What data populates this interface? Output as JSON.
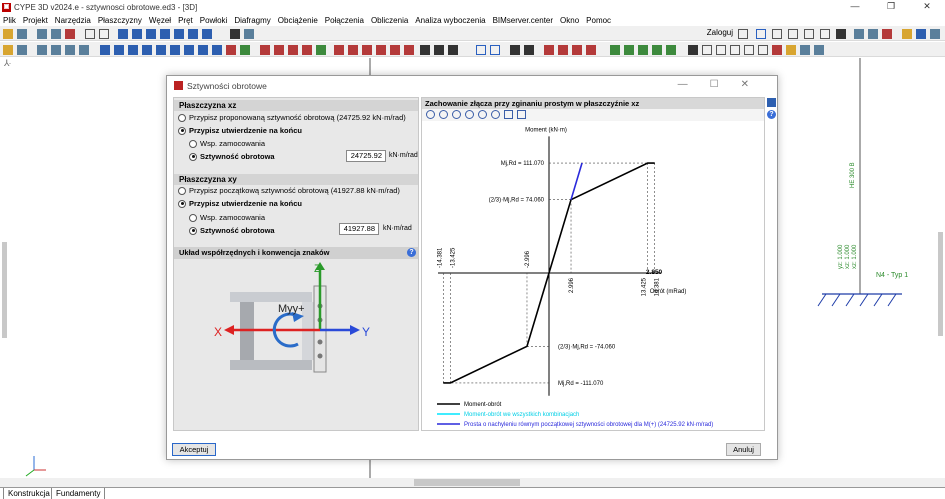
{
  "app": {
    "title": "CYPE 3D v2024.e - sztywnosci obrotowe.ed3 - [3D]",
    "window_controls": [
      "—",
      "❐",
      "✕"
    ]
  },
  "menu": [
    "Plik",
    "Projekt",
    "Narzędzia",
    "Płaszczyzny",
    "Węzeł",
    "Pręt",
    "Powłoki",
    "Diafragmy",
    "Obciążenie",
    "Połączenia",
    "Obliczenia",
    "Analiza wyboczenia",
    "BIMserver.center",
    "Okno",
    "Pomoc"
  ],
  "toolbar": {
    "login_label": "Zaloguj"
  },
  "viewport": {
    "column_label": "HE 300 B",
    "coord_labels": [
      "yz: 1.000",
      "xz: 1.000",
      "xz: 1.000"
    ],
    "node_label": "N4 - Typ 1"
  },
  "tabs": [
    "Konstrukcja",
    "Fundamenty"
  ],
  "dialog": {
    "title": "Sztywności obrotowe",
    "window_controls": [
      "—",
      "☐",
      "✕"
    ],
    "xz": {
      "header": "Płaszczyzna xz",
      "opt_proposed": "Przypisz proponowaną sztywność obrotową (24725.92 kN·m/rad)",
      "opt_assign_end": "Przypisz utwierdzenie na końcu",
      "opt_coef": "Wsp. zamocowania",
      "opt_stiffness": "Sztywność obrotowa",
      "value": "24725.92",
      "unit": "kN·m/rad"
    },
    "xy": {
      "header": "Płaszczyzna xy",
      "opt_initial": "Przypisz początkową sztywność obrotową (41927.88 kN·m/rad)",
      "opt_assign_end": "Przypisz utwierdzenie na końcu",
      "opt_coef": "Wsp. zamocowania",
      "opt_stiffness": "Sztywność obrotowa",
      "value": "41927.88",
      "unit": "kN·m/rad"
    },
    "coord_header": "Układ współrzędnych i konwencja znaków",
    "axes": {
      "z": "Z",
      "x": "X",
      "y": "Y",
      "moment": "Myy+"
    },
    "chart_header": "Zachowanie złącza przy zginaniu prostym w płaszczyźnie xz",
    "accept": "Akceptuj",
    "cancel": "Anuluj"
  },
  "chart_data": {
    "type": "line",
    "ylabel": "Moment (kN·m)",
    "xlabel": "Obrót (mRad)",
    "y_annotations": [
      "Mj,Rd = 111.070",
      "(2/3)·Mj,Rd = 74.060",
      "(2/3)·Mj,Rd = -74.060",
      "Mj,Rd = -111.070"
    ],
    "x_ticks": [
      "-14.381",
      "-13.425",
      "-2.996",
      "2.996",
      "13.425",
      "14.381"
    ],
    "x_axis_end_label": "2.850",
    "series": [
      {
        "name": "Moment-obrót",
        "color": "#000000",
        "x": [
          -14.381,
          -13.425,
          -2.996,
          0,
          2.996,
          13.425,
          14.381
        ],
        "y": [
          -111.07,
          -111.07,
          -74.06,
          0,
          74.06,
          111.07,
          111.07
        ]
      },
      {
        "name": "Moment-obrót we wszystkich kombinacjach",
        "color": "#00e5ff",
        "x": [],
        "y": []
      },
      {
        "name": "Prosta o nachyleniu równym początkowej sztywności obrotowej dla M(+) (24725.92 kN·m/rad)",
        "color": "#2a2adb",
        "x": [
          2.996,
          4.492
        ],
        "y": [
          74.06,
          111.07
        ]
      }
    ]
  }
}
